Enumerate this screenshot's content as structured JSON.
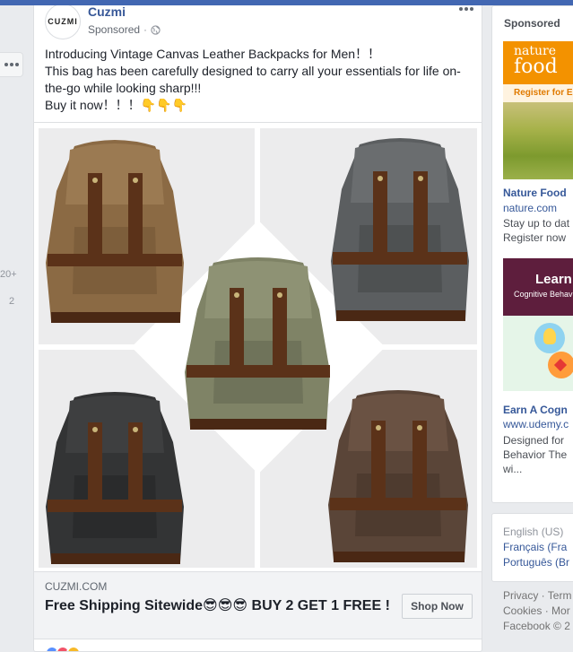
{
  "left": {
    "count_top": "20+",
    "count_bottom": "2"
  },
  "post": {
    "avatar_text": "CUZMI",
    "page_name": "Cuzmi",
    "sponsored": "Sponsored",
    "separator": "·",
    "text_lines": [
      "Introducing Vintage Canvas Leather Backpacks for Men！！",
      "This bag has been carefully designed to carry all your essentials for life on-",
      "the-go while looking sharp!!!",
      "Buy it now！！！👇👇👇"
    ],
    "link": {
      "domain": "CUZMI.COM",
      "headline": "Free Shipping Sitewide😎😎😎 BUY 2 GET 1 FREE !",
      "cta": "Shop Now"
    },
    "bag_colors": {
      "tan": "#8b6a44",
      "grey": "#5b5e60",
      "olive": "#7f8366",
      "black": "#333435",
      "brown": "#5a4538",
      "leather": "#5b3219"
    }
  },
  "right": {
    "sponsored_title": "Sponsored",
    "ads": [
      {
        "logo_line1": "nature",
        "logo_line2": "food",
        "banner_text": "Register for E-",
        "name": "Nature Food",
        "domain": "nature.com",
        "body": [
          "Stay up to dat",
          "Register now"
        ]
      },
      {
        "banner_title": "Learn",
        "banner_sub": "Cognitive Behav",
        "name": "Earn A Cogn",
        "domain": "www.udemy.c",
        "body": [
          "Designed for",
          "Behavior The",
          "wi..."
        ]
      }
    ],
    "languages": {
      "current": "English (US)",
      "others": [
        "Français (Fra",
        "Português (Br"
      ]
    },
    "footer": [
      "Privacy · Term",
      "Cookies · Mor",
      "Facebook © 2"
    ]
  }
}
